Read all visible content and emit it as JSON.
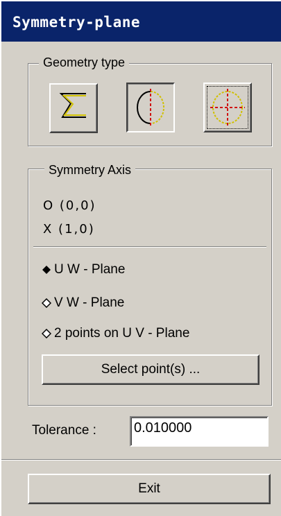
{
  "window": {
    "title": "Symmetry-plane"
  },
  "geometry_type": {
    "label": "Geometry type",
    "buttons": [
      {
        "icon": "open-polyline-icon",
        "state": "raised"
      },
      {
        "icon": "half-circle-axis-icon",
        "state": "pressed"
      },
      {
        "icon": "full-circle-crosshair-icon",
        "state": "raised-focused"
      }
    ]
  },
  "symmetry_axis": {
    "label": "Symmetry Axis",
    "origin": "O (0,0)",
    "x_axis": "X (1,0)",
    "options": [
      {
        "label": "U W - Plane",
        "selected": true
      },
      {
        "label": "V W - Plane",
        "selected": false
      },
      {
        "label": "2 points on U V - Plane",
        "selected": false
      }
    ],
    "select_button": "Select point(s) ..."
  },
  "tolerance": {
    "label": "Tolerance :",
    "value": "0.010000"
  },
  "exit_button": "Exit",
  "colors": {
    "titlebar": "#0a246a",
    "face": "#d4d0c8",
    "accent_red": "#d01010",
    "accent_yellow": "#d0c000"
  }
}
